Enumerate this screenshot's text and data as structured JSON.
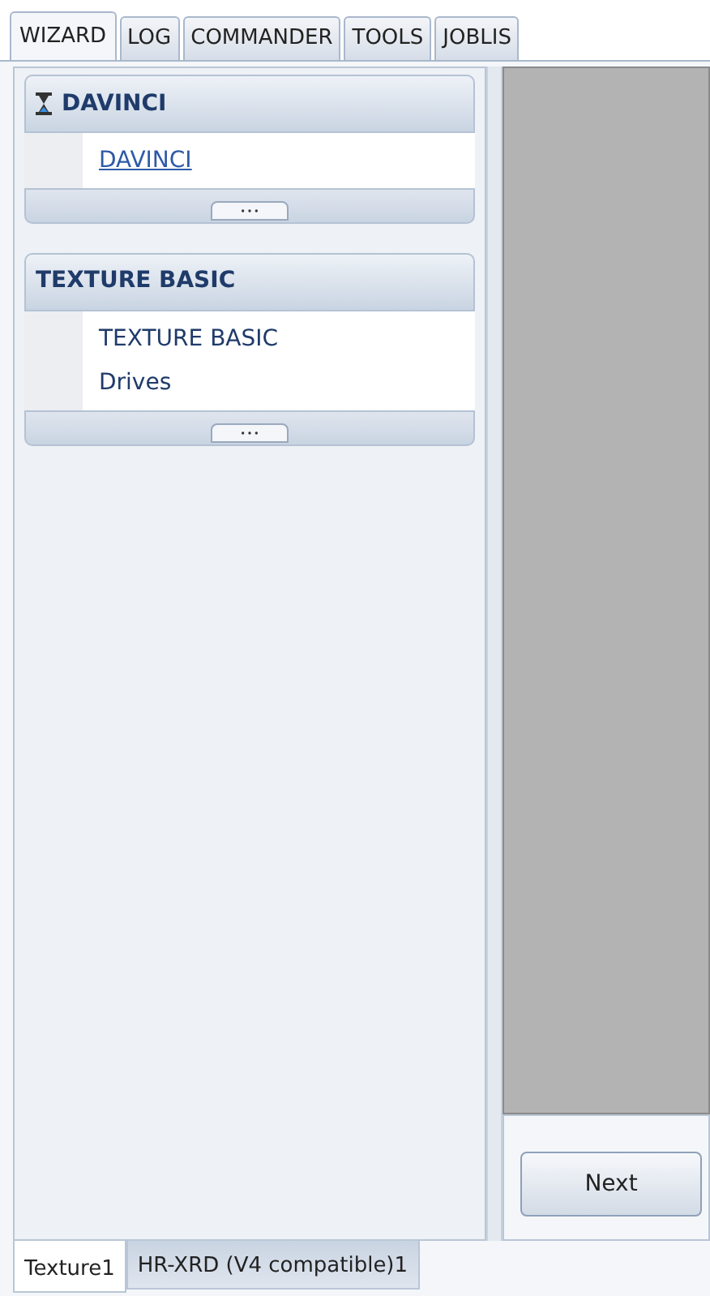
{
  "top_tabs": [
    {
      "label": "WIZARD",
      "selected": true
    },
    {
      "label": "LOG",
      "selected": false
    },
    {
      "label": "COMMANDER",
      "selected": false
    },
    {
      "label": "TOOLS",
      "selected": false
    },
    {
      "label": "JOBLIS",
      "selected": false
    }
  ],
  "sections": [
    {
      "title": "DAVINCI",
      "kind": "busy",
      "items": [
        {
          "label": "DAVINCI",
          "kind": "link"
        }
      ]
    },
    {
      "title": "TEXTURE BASIC",
      "kind": "plain",
      "items": [
        {
          "label": "TEXTURE BASIC",
          "kind": "text"
        },
        {
          "label": "Drives",
          "kind": "text"
        }
      ]
    }
  ],
  "buttons": [
    "Next"
  ],
  "bottom_tabs": [
    {
      "label": "Texture1",
      "selected": true
    },
    {
      "label": "HR-XRD (V4 compatible)1",
      "selected": false
    }
  ]
}
